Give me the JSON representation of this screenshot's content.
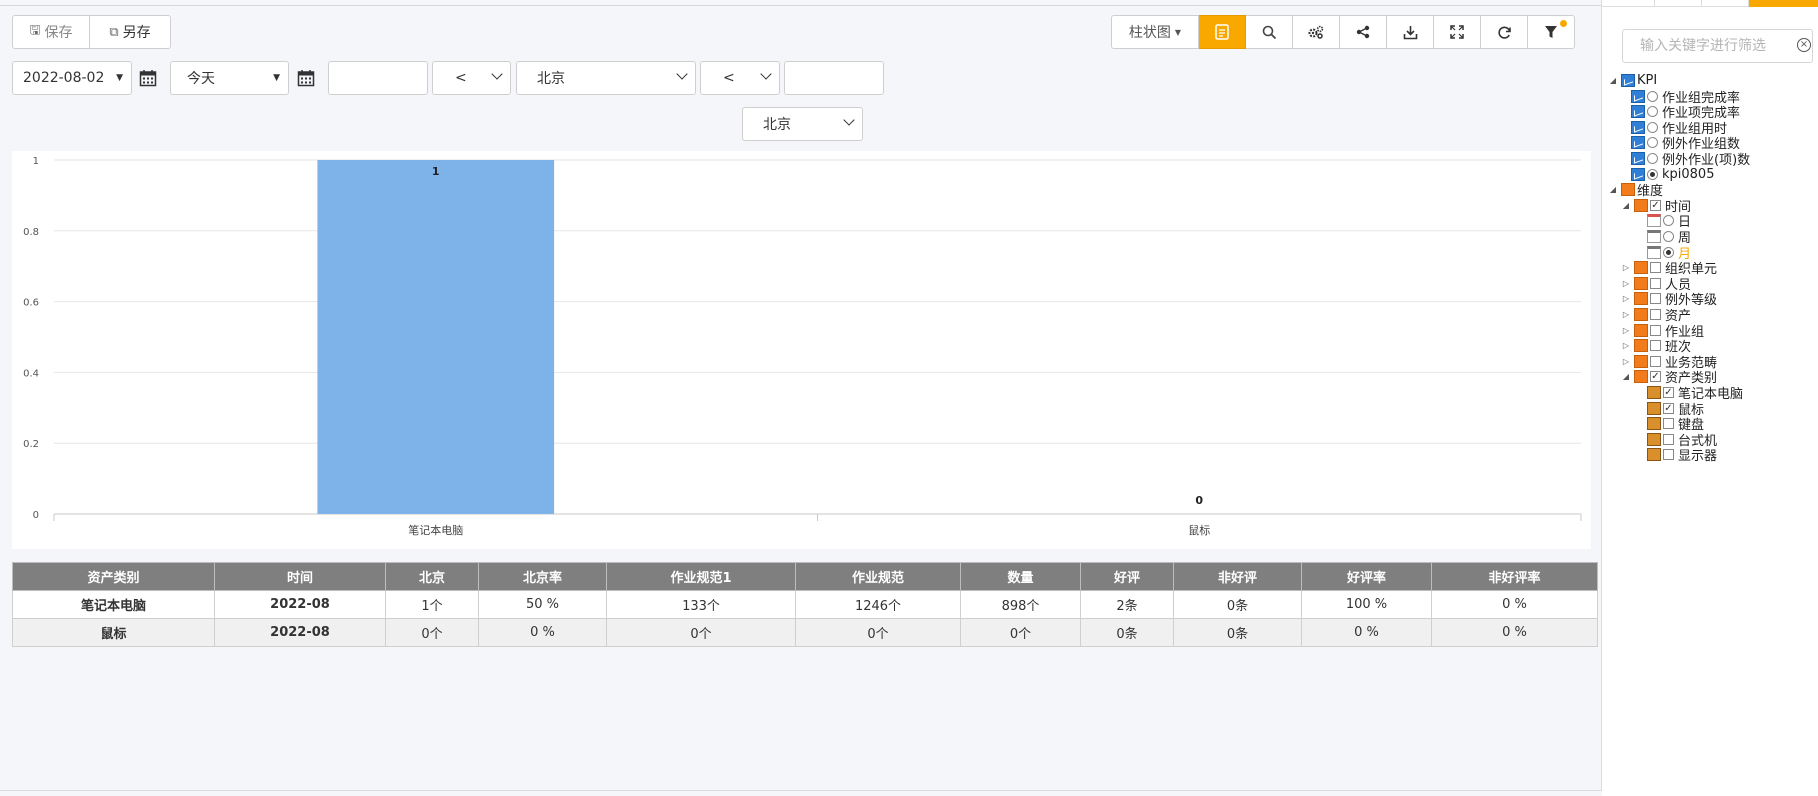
{
  "toolbar": {
    "save_label": "保存",
    "save_as_label": "另存",
    "chart_type_label": "柱状图",
    "buttons": [
      "report-icon",
      "search-icon",
      "settings-icon",
      "share-icon",
      "download-icon",
      "fullscreen-icon",
      "refresh-icon",
      "filter-icon"
    ],
    "accent_color": "#f9a800"
  },
  "filters": {
    "date_value": "2022-08-02",
    "period_value": "今天",
    "text_value_1": "",
    "operator_1": "<",
    "region_value": "北京",
    "operator_2": "<",
    "text_value_2": "",
    "region_value_2": "北京"
  },
  "chart_data": {
    "type": "bar",
    "categories": [
      "笔记本电脑",
      "鼠标"
    ],
    "values": [
      1,
      0
    ],
    "data_labels": [
      "1",
      "0"
    ],
    "yticks": [
      "0",
      "0.2",
      "0.4",
      "0.6",
      "0.8",
      "1"
    ],
    "ylim": [
      0,
      1
    ],
    "bar_color": "#7eb3ea",
    "grid": true
  },
  "table": {
    "columns": [
      "资产类别",
      "时间",
      "北京",
      "北京率",
      "作业规范1",
      "作业规范",
      "数量",
      "好评",
      "非好评",
      "好评率",
      "非好评率"
    ],
    "rows": [
      [
        "笔记本电脑",
        "2022-08",
        "1个",
        "50 %",
        "133个",
        "1246个",
        "898个",
        "2条",
        "0条",
        "100 %",
        "0 %"
      ],
      [
        "鼠标",
        "2022-08",
        "0个",
        "0 %",
        "0个",
        "0个",
        "0个",
        "0条",
        "0条",
        "0 %",
        "0 %"
      ]
    ]
  },
  "panel": {
    "search_placeholder": "输入关键字进行筛选",
    "kpi_root": "KPI",
    "kpi_items": [
      "作业组完成率",
      "作业项完成率",
      "作业组用时",
      "例外作业组数",
      "例外作业(项)数",
      "kpi0805"
    ],
    "dim_root": "维度",
    "time_node": "时间",
    "time_items": [
      "日",
      "周",
      "月"
    ],
    "dim_items": [
      "组织单元",
      "人员",
      "例外等级",
      "资产",
      "作业组",
      "班次",
      "业务范畴"
    ],
    "asset_node": "资产类别",
    "asset_items": [
      "笔记本电脑",
      "鼠标",
      "键盘",
      "台式机",
      "显示器"
    ]
  }
}
